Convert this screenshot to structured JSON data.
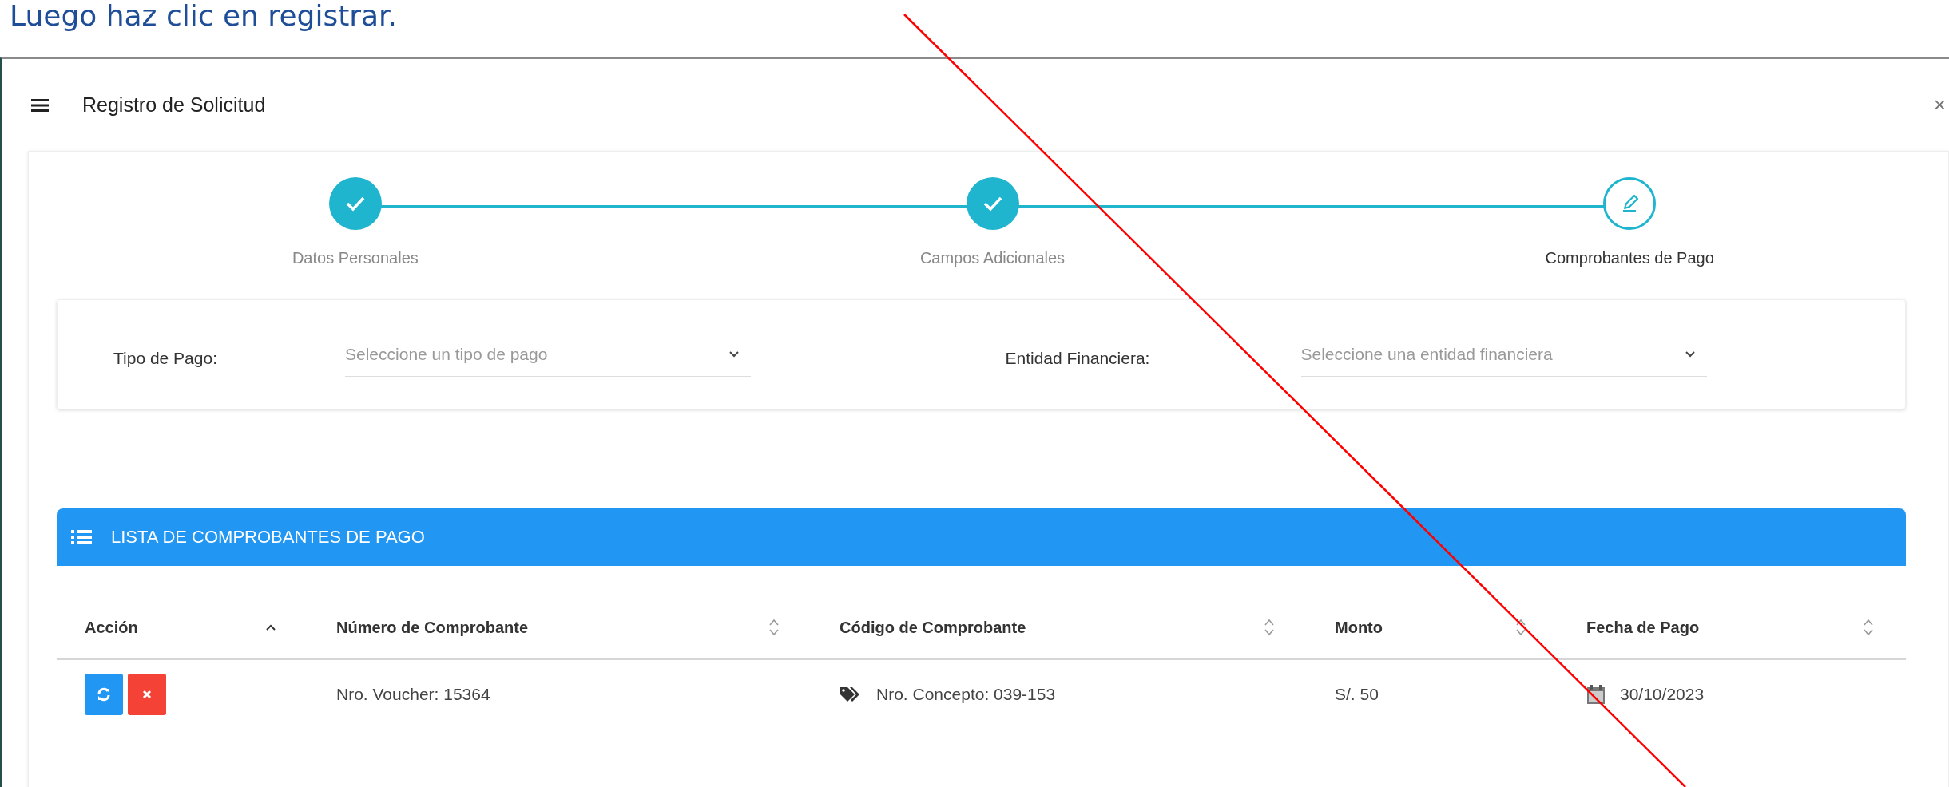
{
  "instruction": "Luego haz clic en registrar.",
  "window": {
    "title": "Registro de Solicitud",
    "close": "×"
  },
  "steps": [
    {
      "label": "Datos Personales",
      "completed": true
    },
    {
      "label": "Campos Adicionales",
      "completed": true
    },
    {
      "label": "Comprobantes de Pago",
      "completed": false
    }
  ],
  "filters": [
    {
      "label": "Tipo de Pago:",
      "placeholder": "Seleccione un tipo de pago"
    },
    {
      "label": "Entidad Financiera:",
      "placeholder": "Seleccione una entidad financiera"
    }
  ],
  "table": {
    "title": "LISTA DE COMPROBANTES DE PAGO",
    "columns": [
      {
        "label": "Acción",
        "sorted": true
      },
      {
        "label": "Número de Comprobante",
        "sorted": false
      },
      {
        "label": "Código de Comprobante",
        "sorted": false
      },
      {
        "label": "Monto",
        "sorted": false
      },
      {
        "label": "Fecha de Pago",
        "sorted": false
      }
    ],
    "rows": [
      {
        "voucher": "Nro. Voucher: 15364",
        "concept": "Nro. Concepto: 039-153",
        "amount": "S/. 50",
        "date": "30/10/2023"
      }
    ]
  }
}
